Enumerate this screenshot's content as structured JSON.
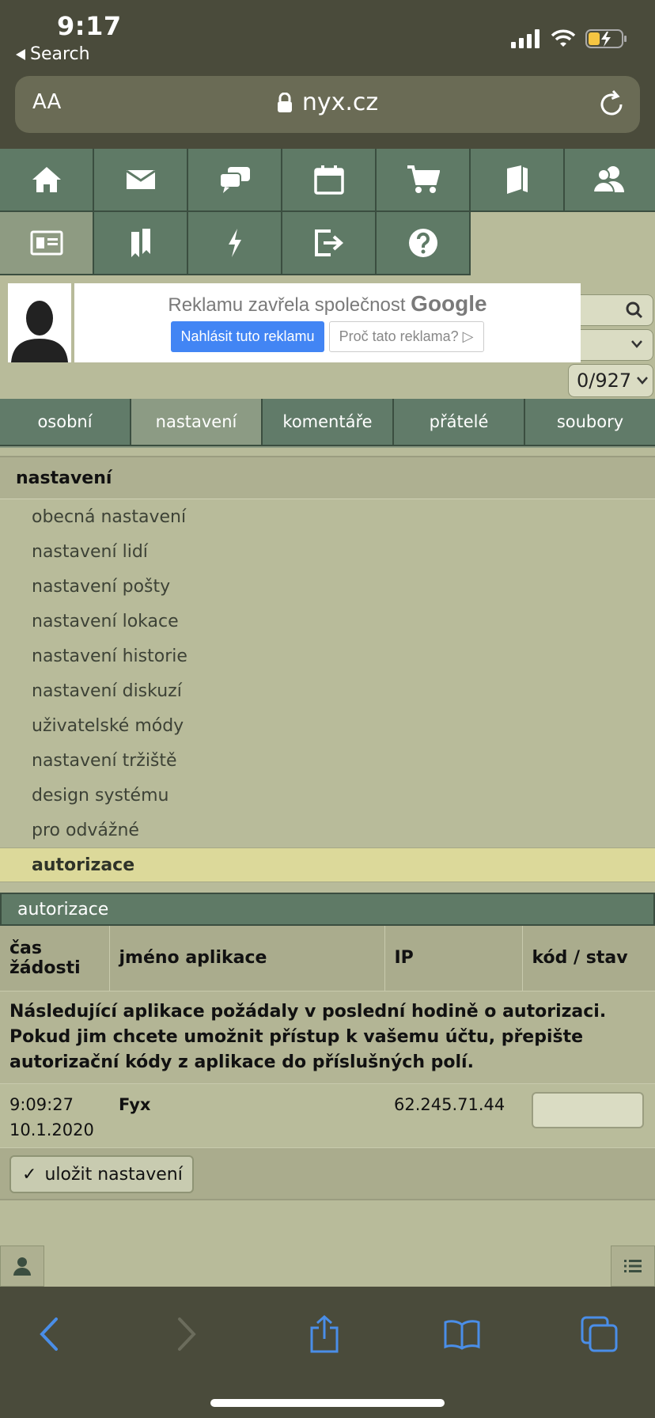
{
  "status_bar": {
    "time": "9:17",
    "back_label": "Search"
  },
  "url_bar": {
    "text_size_label": "AA",
    "domain": "nyx.cz"
  },
  "nav_icons": [
    "home-icon",
    "mail-icon",
    "discussion-icon",
    "calendar-icon",
    "cart-icon",
    "book-icon",
    "users-icon",
    "profile-card-icon",
    "bookmarks-icon",
    "lightning-icon",
    "logout-icon",
    "help-icon"
  ],
  "ad": {
    "closed_text": "Reklamu zavřela společnost",
    "brand": "Google",
    "report_button": "Nahlásit tuto reklamu",
    "why_button": "Proč tato reklama?"
  },
  "pager": {
    "selected": "0/927"
  },
  "tabs": [
    {
      "label": "osobní",
      "active": false
    },
    {
      "label": "nastavení",
      "active": true
    },
    {
      "label": "komentáře",
      "active": false
    },
    {
      "label": "přátelé",
      "active": false
    },
    {
      "label": "soubory",
      "active": false
    }
  ],
  "settings": {
    "header": "nastavení",
    "items": [
      "obecná nastavení",
      "nastavení lidí",
      "nastavení pošty",
      "nastavení lokace",
      "nastavení historie",
      "nastavení diskuzí",
      "uživatelské módy",
      "nastavení tržiště",
      "design systému",
      "pro odvážné",
      "autorizace"
    ],
    "active_item": "autorizace"
  },
  "auth": {
    "title": "autorizace",
    "columns": {
      "time_line1": "čas",
      "time_line2": "žádosti",
      "app": "jméno aplikace",
      "ip": "IP",
      "code": "kód / stav"
    },
    "notice": "Následující aplikace požádaly v poslední hodině o autorizaci. Pokud jim chcete umožnit přístup k vašemu účtu, přepište autorizační kódy z aplikace do příslušných polí.",
    "rows": [
      {
        "time": "9:09:27",
        "date": "10.1.2020",
        "app": "Fyx",
        "ip": "62.245.71.44",
        "code": ""
      }
    ],
    "save_button": "uložit nastavení",
    "save_check": "✓"
  },
  "colors": {
    "tile": "#5f7a66",
    "tile_active": "#8e9b82",
    "page_bg": "#b8bb9a",
    "highlight": "#dcd99a",
    "chrome": "#4a4b3b",
    "safari_blue": "#4a8ee8"
  }
}
